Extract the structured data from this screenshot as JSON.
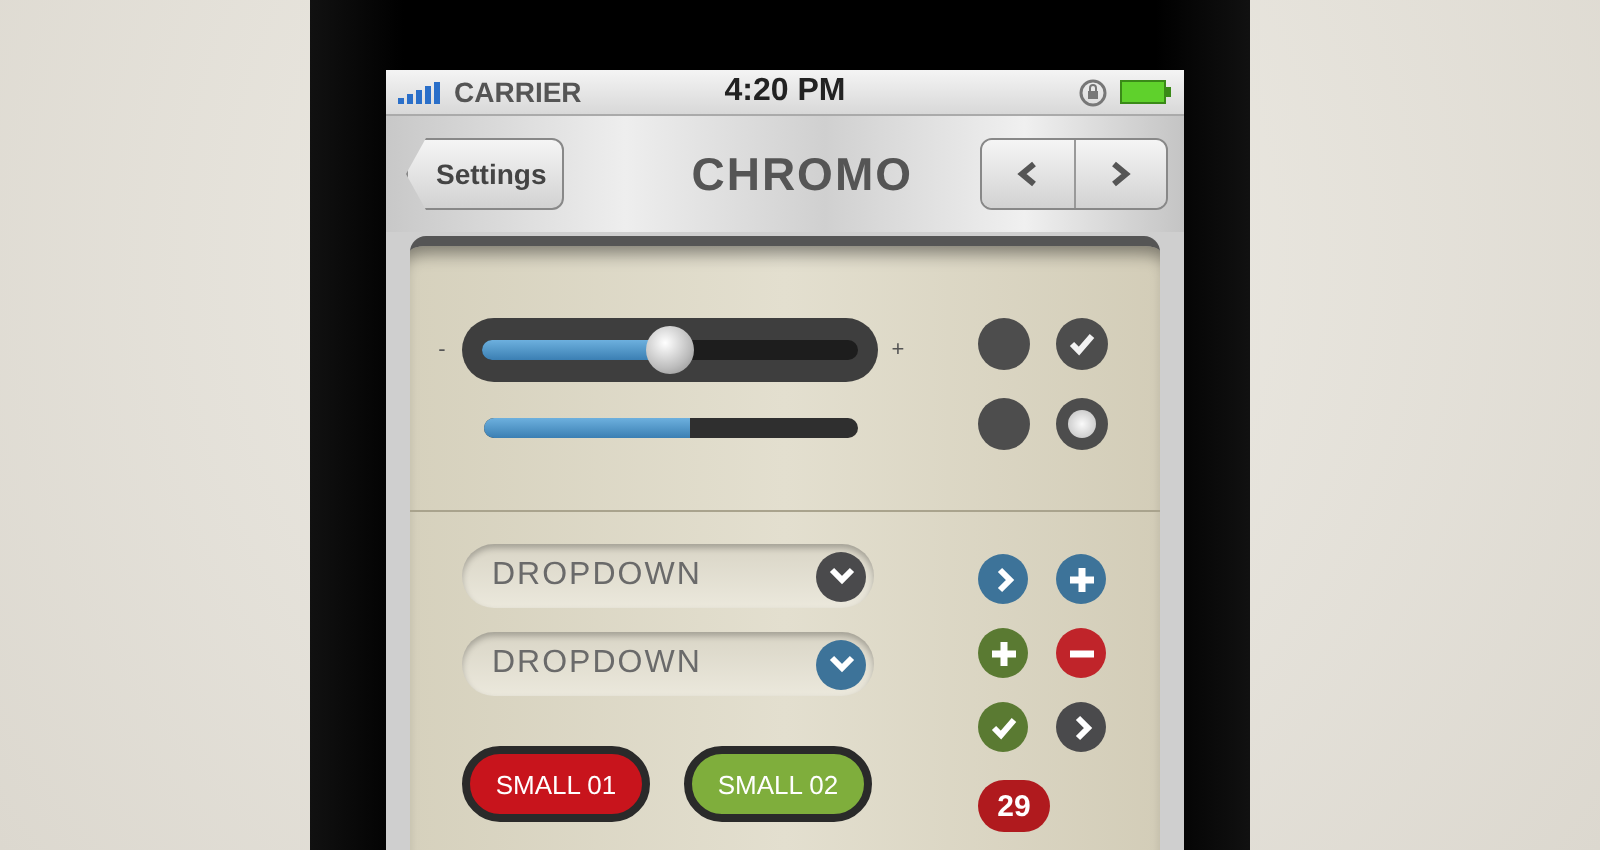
{
  "status_bar": {
    "carrier": "CARRIER",
    "time": "4:20 PM"
  },
  "nav_bar": {
    "back": "Settings",
    "title": "CHROMO"
  },
  "slider": {
    "min_label": "-",
    "max_label": "+",
    "level": 0.5
  },
  "progress": {
    "level": 0.55
  },
  "toggles": [
    {
      "kind": "check",
      "checked": false
    },
    {
      "kind": "check",
      "checked": true
    },
    {
      "kind": "radio",
      "selected": false
    },
    {
      "kind": "radio",
      "selected": true
    }
  ],
  "dropdowns": [
    {
      "label": "DROPDOWN",
      "color": "#4a4a4c"
    },
    {
      "label": "DROPDOWN",
      "color": "#3d7399"
    }
  ],
  "small_buttons": [
    {
      "label": "SMALL 01",
      "color": "#c8141c"
    },
    {
      "label": "SMALL 02",
      "color": "#7fae3c"
    }
  ],
  "round_icons": [
    {
      "kind": "chevron",
      "color": "#3d7399"
    },
    {
      "kind": "plus",
      "color": "#3d7399"
    },
    {
      "kind": "plus",
      "color": "#5a7a32"
    },
    {
      "kind": "minus",
      "color": "#c0242a"
    },
    {
      "kind": "check",
      "color": "#5a7a32"
    },
    {
      "kind": "chevron",
      "color": "#4a4a4c"
    }
  ],
  "badge": "29"
}
